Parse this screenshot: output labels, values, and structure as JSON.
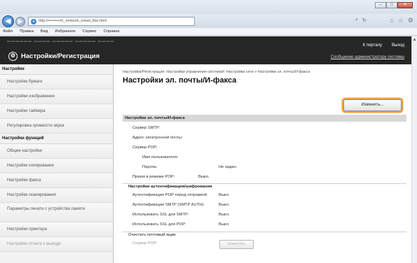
{
  "browser": {
    "url": "http://••••••••/m_network_email_ifax.html",
    "search_icon": "search-icon",
    "menu": [
      "Файл",
      "Правка",
      "Вид",
      "Избранное",
      "Сервис",
      "Справка"
    ]
  },
  "header": {
    "brand": "Настройки/Регистрация",
    "portal_link": "К порталу",
    "logout_link": "Выход",
    "support_link": "Сообщение администратору системы"
  },
  "sidebar": {
    "settings_head": "Настройки",
    "settings_items": [
      "Настройки бумаги",
      "Настройки изображения",
      "Настройки таймера",
      "Регулировка громкости звука"
    ],
    "functions_head": "Настройки функций",
    "function_items": [
      "Общие настройки",
      "Настройки копирования",
      "Настройки факса",
      "Настройки сканирования",
      "Параметры печати с устройства памяти",
      "Настройки принтера",
      "Настройки отчета о выводе"
    ]
  },
  "main": {
    "breadcrumb": "Настройки/Регистрация: Настройки управления системой: Настройки сети > Настройки эл. почты/И-факса",
    "title": "Настройки эл. почты/И-факса",
    "edit_button": "Изменить...",
    "section_title": "Настройки эл. почты/И-факса",
    "smtp_server": "Сервер SMTP:",
    "email_address": "Адрес электронной почты:",
    "pop_server": "Сервер POP:",
    "user_name": "Имя пользователя:",
    "password_label": "Пароль:",
    "password_value": "Не задан.",
    "pop_receive_label": "Прием в режиме POP:",
    "pop_receive_value": "Выкл.",
    "auth_head": "Настройки аутентификации/шифрования",
    "auth_rows": [
      {
        "label": "Аутентификация POP перед отправкой:",
        "value": "Выкл."
      },
      {
        "label": "Аутентификация SMTP (SMTP AUTH):",
        "value": "Выкл."
      },
      {
        "label": "Использовать SSL для SMTP:",
        "value": "Выкл."
      },
      {
        "label": "Использовать SSL для POP:",
        "value": "Выкл."
      }
    ],
    "clear_head": "Очистить почтовый ящик",
    "clear_pop_label": "Сервер POP:",
    "clear_button": "Очистить"
  }
}
